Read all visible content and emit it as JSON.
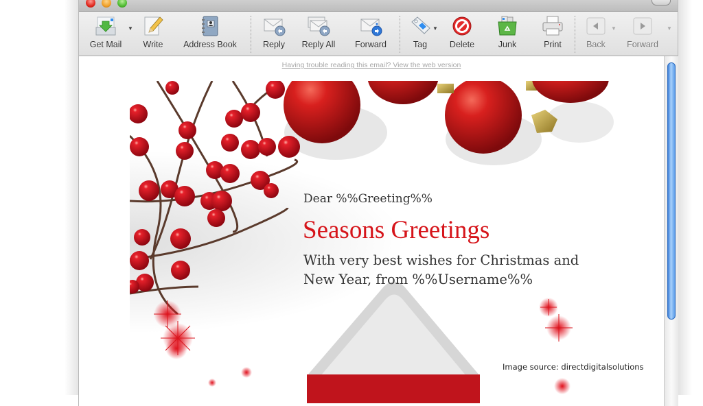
{
  "window": {
    "title_buttons": [
      "close",
      "minimize",
      "zoom"
    ]
  },
  "toolbar": {
    "items": [
      {
        "id": "get-mail",
        "label": "Get Mail",
        "icon": "inbox-download-icon",
        "has_menu": true,
        "enabled": true
      },
      {
        "id": "write",
        "label": "Write",
        "icon": "compose-pencil-icon",
        "has_menu": false,
        "enabled": true
      },
      {
        "id": "address-book",
        "label": "Address Book",
        "icon": "address-book-icon",
        "has_menu": false,
        "enabled": true
      },
      {
        "id": "reply",
        "label": "Reply",
        "icon": "reply-envelope-icon",
        "has_menu": false,
        "enabled": true
      },
      {
        "id": "reply-all",
        "label": "Reply All",
        "icon": "reply-all-envelope-icon",
        "has_menu": false,
        "enabled": true
      },
      {
        "id": "forward",
        "label": "Forward",
        "icon": "forward-envelope-icon",
        "has_menu": false,
        "enabled": true
      },
      {
        "id": "tag",
        "label": "Tag",
        "icon": "tag-icon",
        "has_menu": true,
        "enabled": true
      },
      {
        "id": "delete",
        "label": "Delete",
        "icon": "delete-no-entry-icon",
        "has_menu": false,
        "enabled": true
      },
      {
        "id": "junk",
        "label": "Junk",
        "icon": "junk-bin-icon",
        "has_menu": false,
        "enabled": true
      },
      {
        "id": "print",
        "label": "Print",
        "icon": "printer-icon",
        "has_menu": false,
        "enabled": true
      },
      {
        "id": "back",
        "label": "Back",
        "icon": "back-arrow-icon",
        "has_menu": true,
        "enabled": false
      },
      {
        "id": "nav-forward",
        "label": "Forward",
        "icon": "forward-arrow-icon",
        "has_menu": true,
        "enabled": false
      }
    ]
  },
  "email": {
    "web_version_link": "Having trouble reading this email? View the web version",
    "greeting": "Dear %%Greeting%%",
    "headline": "Seasons Greetings",
    "message": "With very best wishes for Christmas and New Year, from %%Username%%",
    "colors": {
      "headline": "#d6141a",
      "accent_red": "#c8141c"
    }
  },
  "caption": "Image source: directdigitalsolutions"
}
